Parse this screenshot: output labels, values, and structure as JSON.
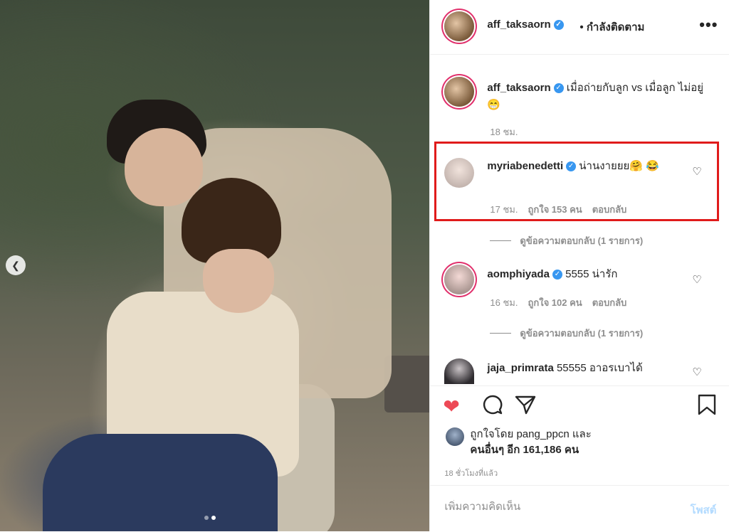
{
  "post": {
    "author": "aff_taksaorn",
    "follow_label": "• กำลังติดตาม",
    "more_label": "•••"
  },
  "caption": {
    "username": "aff_taksaorn",
    "text": "เมื่อถ่ายกับลูก vs เมื่อลูก ไม่อยู่ 😁",
    "time": "18 ชม."
  },
  "comments": [
    {
      "username": "myriabenedetti",
      "text": "น่านงายยย🤗 😂",
      "time": "17 ชม.",
      "likes": "ถูกใจ 153 คน",
      "reply": "ตอบกลับ",
      "view_replies": "ดูข้อความตอบกลับ (1 รายการ)"
    },
    {
      "username": "aomphiyada",
      "text": "5555 น่ารัก",
      "time": "16 ชม.",
      "likes": "ถูกใจ 102 คน",
      "reply": "ตอบกลับ",
      "view_replies": "ดูข้อความตอบกลับ (1 รายการ)"
    },
    {
      "username": "jaja_primrata",
      "text": "55555 อาอรเบาได้"
    }
  ],
  "liked_by": {
    "line1": "ถูกใจโดย pang_ppcn และ",
    "line2": "คนอื่นๆ อีก 161,186 คน"
  },
  "time_ago": "18 ชั่วโมงที่แล้ว",
  "composer": {
    "placeholder": "เพิ่มความคิดเห็น",
    "post_label": "โพสต์"
  },
  "icons": {
    "like": "heart-icon",
    "comment": "comment-icon",
    "share": "share-icon",
    "save": "bookmark-icon",
    "verified": "verified-badge-icon",
    "prev": "chevron-left-icon"
  },
  "colors": {
    "like_red": "#ed4956",
    "verified_blue": "#3897f0",
    "highlight_red": "#e01b1b"
  }
}
